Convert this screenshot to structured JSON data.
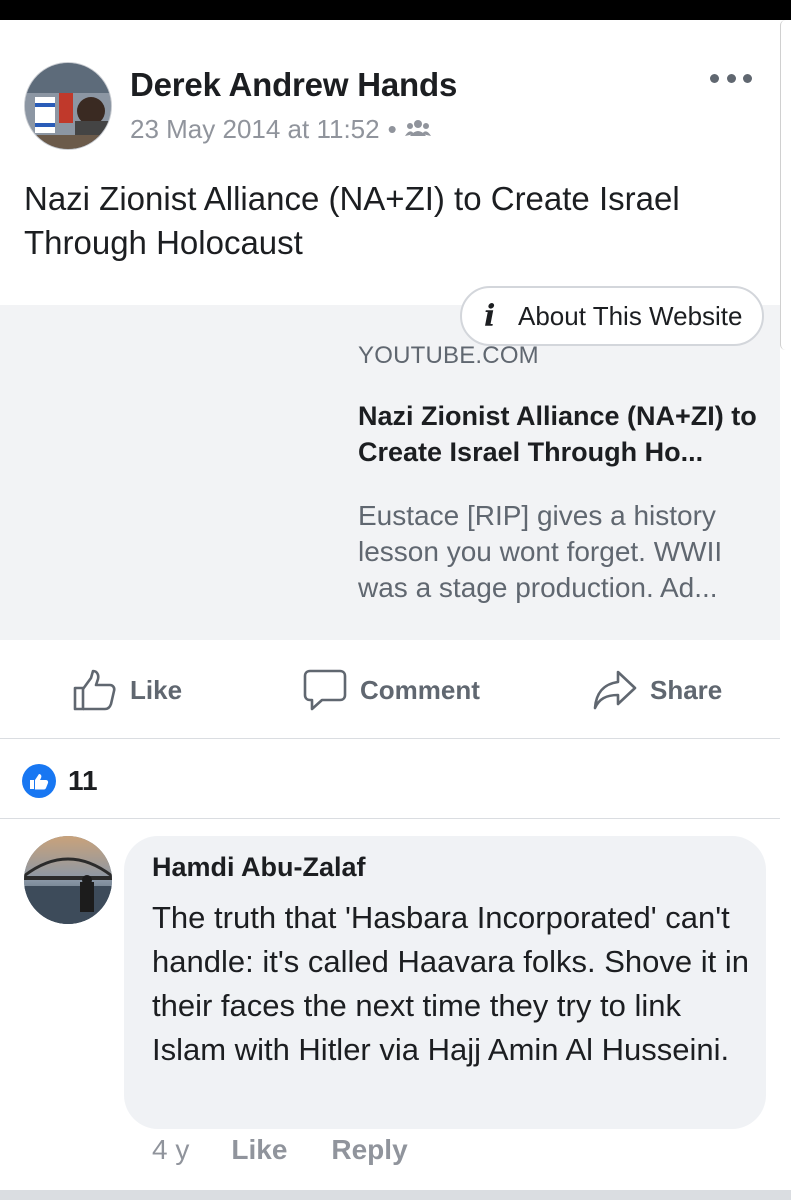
{
  "post": {
    "author": "Derek Andrew Hands",
    "timestamp": "23 May 2014 at 11:52",
    "separator": "•",
    "audience_icon": "friends-icon",
    "more_icon": "more-horizontal-icon",
    "text": "Nazi Zionist Alliance (NA+ZI) to Create Israel Through Holocaust"
  },
  "link_preview": {
    "about_label": "About This Website",
    "about_icon": "info-icon",
    "domain": "YOUTUBE.COM",
    "title": "Nazi Zionist Alliance (NA+ZI) to Create Israel Through Ho...",
    "description": "Eustace [RIP] gives a history lesson you wont forget. WWII was a stage production. Ad..."
  },
  "actions": {
    "like": "Like",
    "comment": "Comment",
    "share": "Share"
  },
  "reactions": {
    "count": "11",
    "icon": "thumbs-up-icon",
    "color": "#1877f2"
  },
  "comment": {
    "author": "Hamdi Abu-Zalaf",
    "text": "The truth that 'Hasbara Incorporated' can't handle: it's called Haavara folks. Shove it in their faces the next time they try to link Islam with Hitler via Hajj Amin Al Husseini.",
    "age": "4 y",
    "like": "Like",
    "reply": "Reply"
  },
  "colors": {
    "text_primary": "#1c1e21",
    "text_secondary": "#606770",
    "card_bg": "#f2f3f5",
    "bubble_bg": "#f0f2f5"
  }
}
